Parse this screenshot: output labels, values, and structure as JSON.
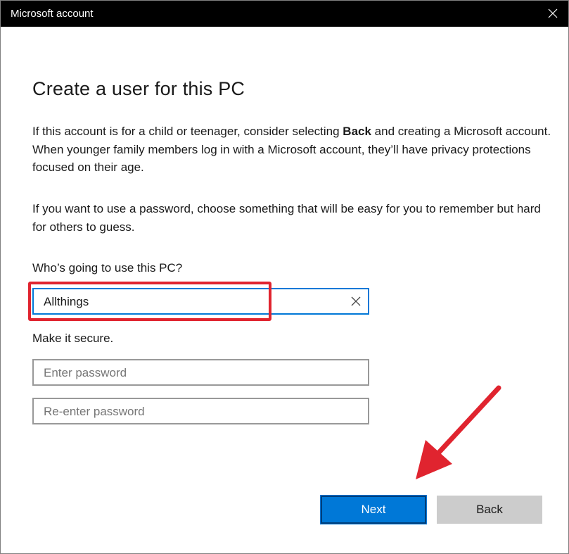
{
  "window": {
    "title": "Microsoft account"
  },
  "heading": "Create a user for this PC",
  "paragraph1": {
    "part1": "If this account is for a child or teenager, consider selecting ",
    "bold": "Back",
    "part2": " and creating a Microsoft account. When younger family members log in with a Microsoft account, they’ll have privacy protections focused on their age."
  },
  "paragraph2": "If you want to use a password, choose something that will be easy for you to remember but hard for others to guess.",
  "user_field": {
    "label": "Who’s going to use this PC?",
    "value": "Allthings"
  },
  "secure_label": "Make it secure.",
  "password_field": {
    "placeholder": "Enter password"
  },
  "reenter_field": {
    "placeholder": "Re-enter password"
  },
  "buttons": {
    "next": "Next",
    "back": "Back"
  },
  "icons": {
    "close": "close-icon",
    "clear": "clear-x-icon",
    "annotation_arrow": "red-arrow-annotation"
  },
  "colors": {
    "accent": "#0078d7",
    "annotation": "#e0242f",
    "titlebar": "#000000",
    "back_button": "#cccccc"
  }
}
